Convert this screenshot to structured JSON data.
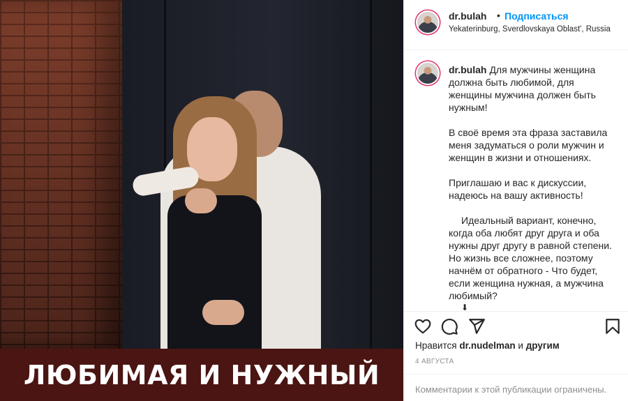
{
  "photo": {
    "caption": "ЛЮБИМАЯ И НУЖНЫЙ"
  },
  "header": {
    "username": "dr.bulah",
    "separator": "•",
    "follow_label": "Подписаться",
    "location": "Yekaterinburg, Sverdlovskaya Oblast', Russia"
  },
  "post": {
    "username": "dr.bulah",
    "paragraph1": "Для мужчины женщина должна быть любимой, для женщины мужчина должен быть нужным!",
    "paragraph2": "В своё время эта фраза заставила меня задуматься о роли мужчин и женщин в жизни и отношениях.",
    "paragraph3": "Приглашаю и вас к дискуссии, надеюсь на вашу активность!",
    "paragraph4": "Идеальный вариант, конечно, когда оба любят друг друга и оба нужны друг другу в равной степени. Но жизнь все сложнее, поэтому начнём от обратного - Что будет, если женщина нужная, а мужчина любимый?",
    "arrow": "⬇"
  },
  "actions": {
    "like_icon": "heart-icon",
    "comment_icon": "comment-icon",
    "share_icon": "paper-plane-icon",
    "save_icon": "bookmark-icon"
  },
  "likes": {
    "prefix": "Нравится",
    "user": "dr.nudelman",
    "connector": "и",
    "others": "другим"
  },
  "date": "4 АВГУСТА",
  "comments_notice": "Комментарии к этой публикации ограничены."
}
